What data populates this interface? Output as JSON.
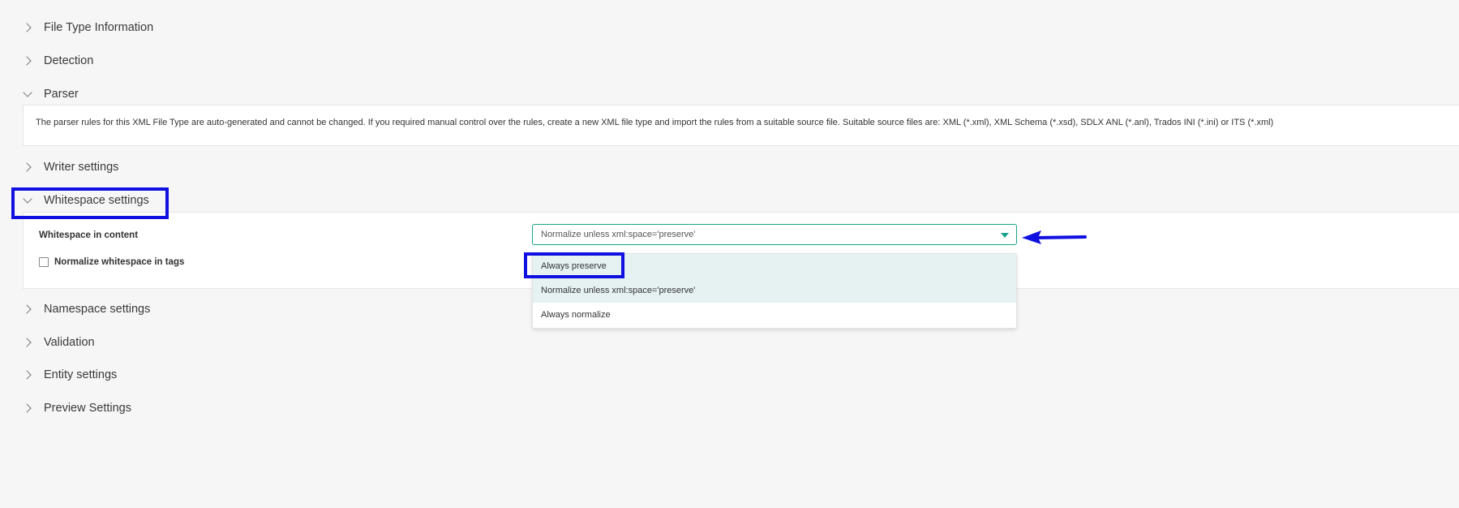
{
  "sections": {
    "file_type_information": "File Type Information",
    "detection": "Detection",
    "parser": "Parser",
    "writer_settings": "Writer settings",
    "whitespace_settings": "Whitespace settings",
    "namespace_settings": "Namespace settings",
    "validation": "Validation",
    "entity_settings": "Entity settings",
    "preview_settings": "Preview Settings"
  },
  "parser_panel": {
    "text": "The parser rules for this XML File Type are auto-generated and cannot be changed. If you required manual control over the rules, create a new XML file type and import the rules from a suitable source file. Suitable source files are: XML (*.xml), XML Schema (*.xsd), SDLX ANL (*.anl), Trados INI (*.ini) or ITS (*.xml)"
  },
  "whitespace_panel": {
    "content_label": "Whitespace in content",
    "select_value": "Normalize unless xml:space='preserve'",
    "normalize_tags_label": "Normalize whitespace in tags",
    "normalize_tags_checked": false,
    "options": [
      "Always preserve",
      "Normalize unless xml:space='preserve'",
      "Always normalize"
    ]
  },
  "icons": {
    "collapsed": "chevron-right-icon",
    "expanded": "chevron-down-icon",
    "dropdown": "caret-down-icon",
    "annotation_arrow": "arrow-left-icon"
  },
  "colors": {
    "accent": "#17a38b",
    "annotation": "#1010e0",
    "highlight": "#e6f1f1",
    "background": "#f6f6f6"
  }
}
